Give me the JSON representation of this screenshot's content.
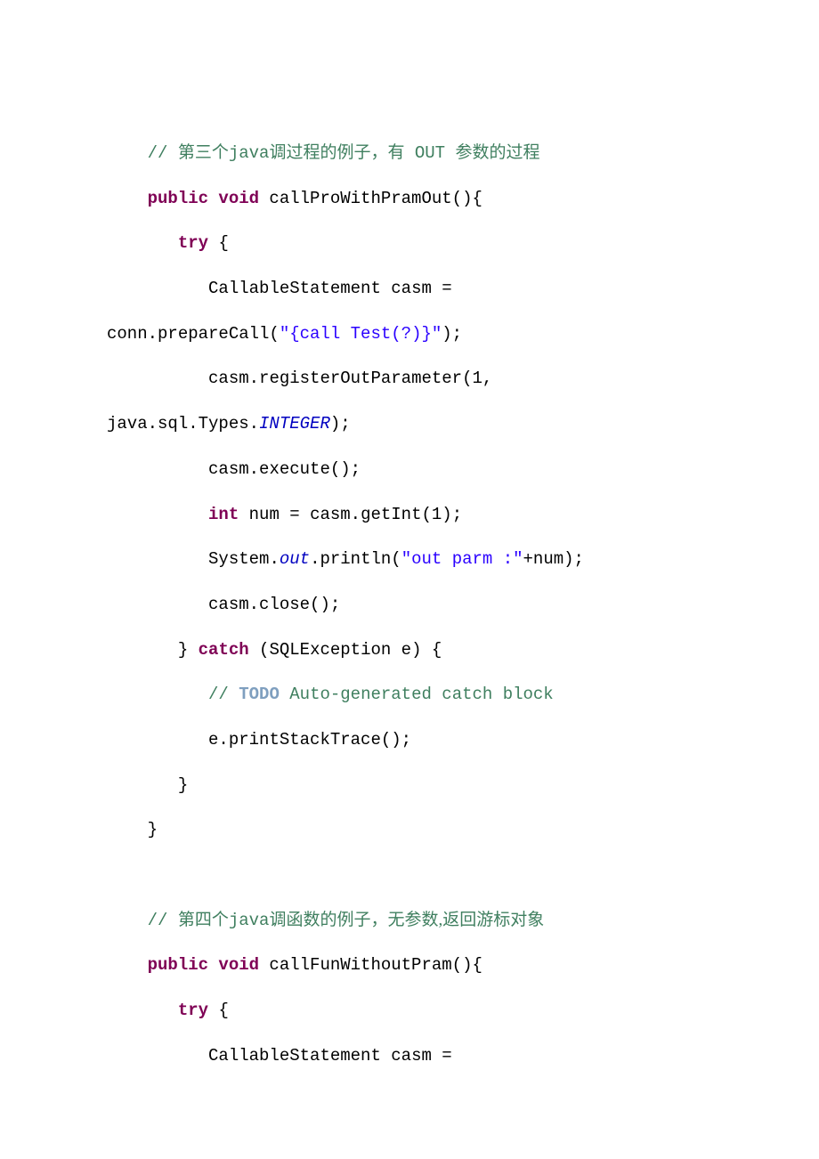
{
  "lines": {
    "c1_ind": "    ",
    "c1_slash": "// ",
    "c1_cn1": "第三个",
    "c1_java": "java",
    "c1_cn2": "调过程的例子，有",
    "c1_out": " OUT ",
    "c1_cn3": "参数的过程",
    "l2_ind": "    ",
    "l2_kw": "public void",
    "l2_rest": " callProWithPramOut(){",
    "l3_ind": "       ",
    "l3_kw": "try",
    "l3_rest": " {",
    "l4_ind": "          ",
    "l4_txt": "CallableStatement casm = ",
    "l5_pre": "conn",
    "l5_mid": ".prepareCall(",
    "l5_str": "\"{call Test(?)}\"",
    "l5_end": ");",
    "l6_ind": "          ",
    "l6_txt": "casm.registerOutParameter(1, ",
    "l7_pre": "java.sql.Types.",
    "l7_fld": "INTEGER",
    "l7_end": ");",
    "l8_ind": "          ",
    "l8_txt": "casm.execute();",
    "l9_ind": "          ",
    "l9_kw": "int",
    "l9_rest": " num = casm.getInt(1);",
    "l10_ind": "          ",
    "l10_a": "System.",
    "l10_fld": "out",
    "l10_b": ".println(",
    "l10_str": "\"out parm :\"",
    "l10_c": "+num);",
    "l11_ind": "          ",
    "l11_txt": "casm.close();",
    "l12_ind": "       ",
    "l12_a": "} ",
    "l12_kw": "catch",
    "l12_b": " (SQLException e) {",
    "l13_ind": "          ",
    "l13_slash": "// ",
    "l13_tag": "TODO",
    "l13_rest": " Auto-generated catch block",
    "l14_ind": "          ",
    "l14_txt": "e.printStackTrace();",
    "l15_ind": "       ",
    "l15_txt": "}",
    "l16_ind": "    ",
    "l16_txt": "}",
    "c2_ind": "    ",
    "c2_slash": "// ",
    "c2_cn1": "第四个",
    "c2_java": "java",
    "c2_cn2": "调函数的例子，无参数,返回游标对象",
    "l18_ind": "    ",
    "l18_kw": "public void",
    "l18_rest": " callFunWithoutPram(){",
    "l19_ind": "       ",
    "l19_kw": "try",
    "l19_rest": " {",
    "l20_ind": "          ",
    "l20_txt": "CallableStatement casm = "
  }
}
